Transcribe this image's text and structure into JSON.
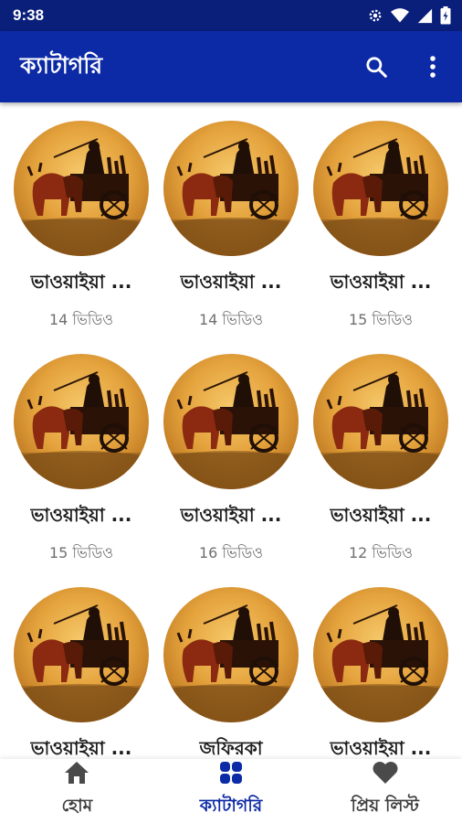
{
  "status_bar": {
    "time": "9:38"
  },
  "app_bar": {
    "title": "ক্যাটাগরি",
    "search_icon": "search-icon",
    "more_icon": "more-vert-icon"
  },
  "colors": {
    "status_bar": "#0a1f7a",
    "app_bar": "#0d2aa6",
    "accent": "#0d2aa6"
  },
  "categories": [
    {
      "title": "ভাওয়াইয়া ...",
      "count": "14 ভিডিও"
    },
    {
      "title": "ভাওয়াইয়া ...",
      "count": "14 ভিডিও"
    },
    {
      "title": "ভাওয়াইয়া ...",
      "count": "15 ভিডিও"
    },
    {
      "title": "ভাওয়াইয়া ...",
      "count": "15 ভিডিও"
    },
    {
      "title": "ভাওয়াইয়া ...",
      "count": "16 ভিডিও"
    },
    {
      "title": "ভাওয়াইয়া ...",
      "count": "12 ভিডিও"
    },
    {
      "title": "ভাওয়াইয়া ...",
      "count": ""
    },
    {
      "title": "জফিরকা",
      "count": ""
    },
    {
      "title": "ভাওয়াইয়া ...",
      "count": ""
    }
  ],
  "bottom_nav": {
    "items": [
      {
        "label": "হোম",
        "icon": "home-icon"
      },
      {
        "label": "ক্যাটাগরি",
        "icon": "grid-icon",
        "active": true
      },
      {
        "label": "প্রিয় লিস্ট",
        "icon": "heart-icon"
      }
    ]
  }
}
